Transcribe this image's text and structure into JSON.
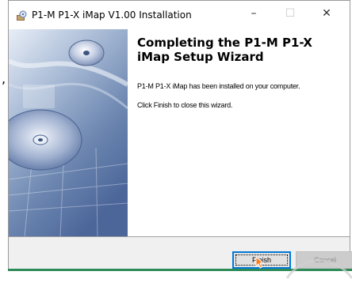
{
  "window": {
    "title": "P1-M P1-X iMap V1.00 Installation",
    "controls": {
      "minimize": "–",
      "maximize": "☐",
      "close": "✕"
    }
  },
  "background": {
    "comma": ","
  },
  "content": {
    "heading": "Completing the P1-M P1-X iMap Setup Wizard",
    "line1": "P1-M P1-X iMap has been installed on your computer.",
    "line2": "Click Finish to close this wizard."
  },
  "footer": {
    "finish_label": "Finish",
    "cancel_label": "Cancel"
  },
  "colors": {
    "focus_border": "#0078d7",
    "side_art": "#6e88b0",
    "taskbar_green": "#2e8b57"
  },
  "icons": {
    "app": "installer-icon",
    "cursor": "mouse-pointer-icon"
  }
}
